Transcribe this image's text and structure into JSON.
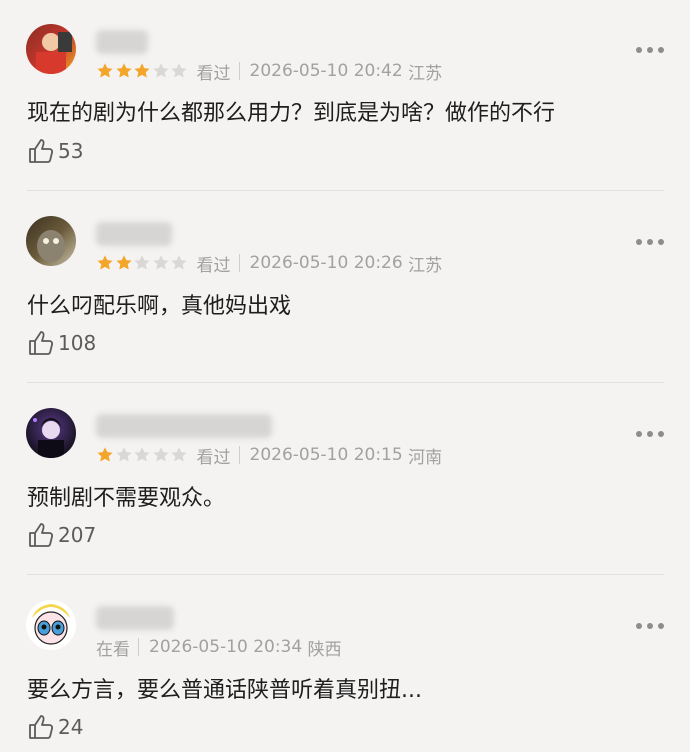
{
  "comments": [
    {
      "rating": 3,
      "status": "看过",
      "time": "2026-05-10 20:42",
      "location": "江苏",
      "text": "现在的剧为什么都那么用力？到底是为啥？做作的不行",
      "likes": "53",
      "avatar_colors": [
        "#c0352c",
        "#f2a623"
      ]
    },
    {
      "rating": 2,
      "status": "看过",
      "time": "2026-05-10 20:26",
      "location": "江苏",
      "text": "什么叼配乐啊，真他妈出戏",
      "likes": "108",
      "avatar_colors": [
        "#6b5a3a",
        "#c9c2a8"
      ]
    },
    {
      "rating": 1,
      "status": "看过",
      "time": "2026-05-10 20:15",
      "location": "河南",
      "text": "预制剧不需要观众。",
      "likes": "207",
      "avatar_colors": [
        "#1a1424",
        "#8d4fd6"
      ]
    },
    {
      "rating": 0,
      "status": "在看",
      "time": "2026-05-10 20:34",
      "location": "陕西",
      "text": "要么方言，要么普通话陕普听着真别扭...",
      "likes": "24",
      "avatar_colors": [
        "#f4d64a",
        "#4a9fd8"
      ]
    }
  ],
  "colors": {
    "star_on": "#f4a62a",
    "star_off": "#d9d8d6"
  }
}
